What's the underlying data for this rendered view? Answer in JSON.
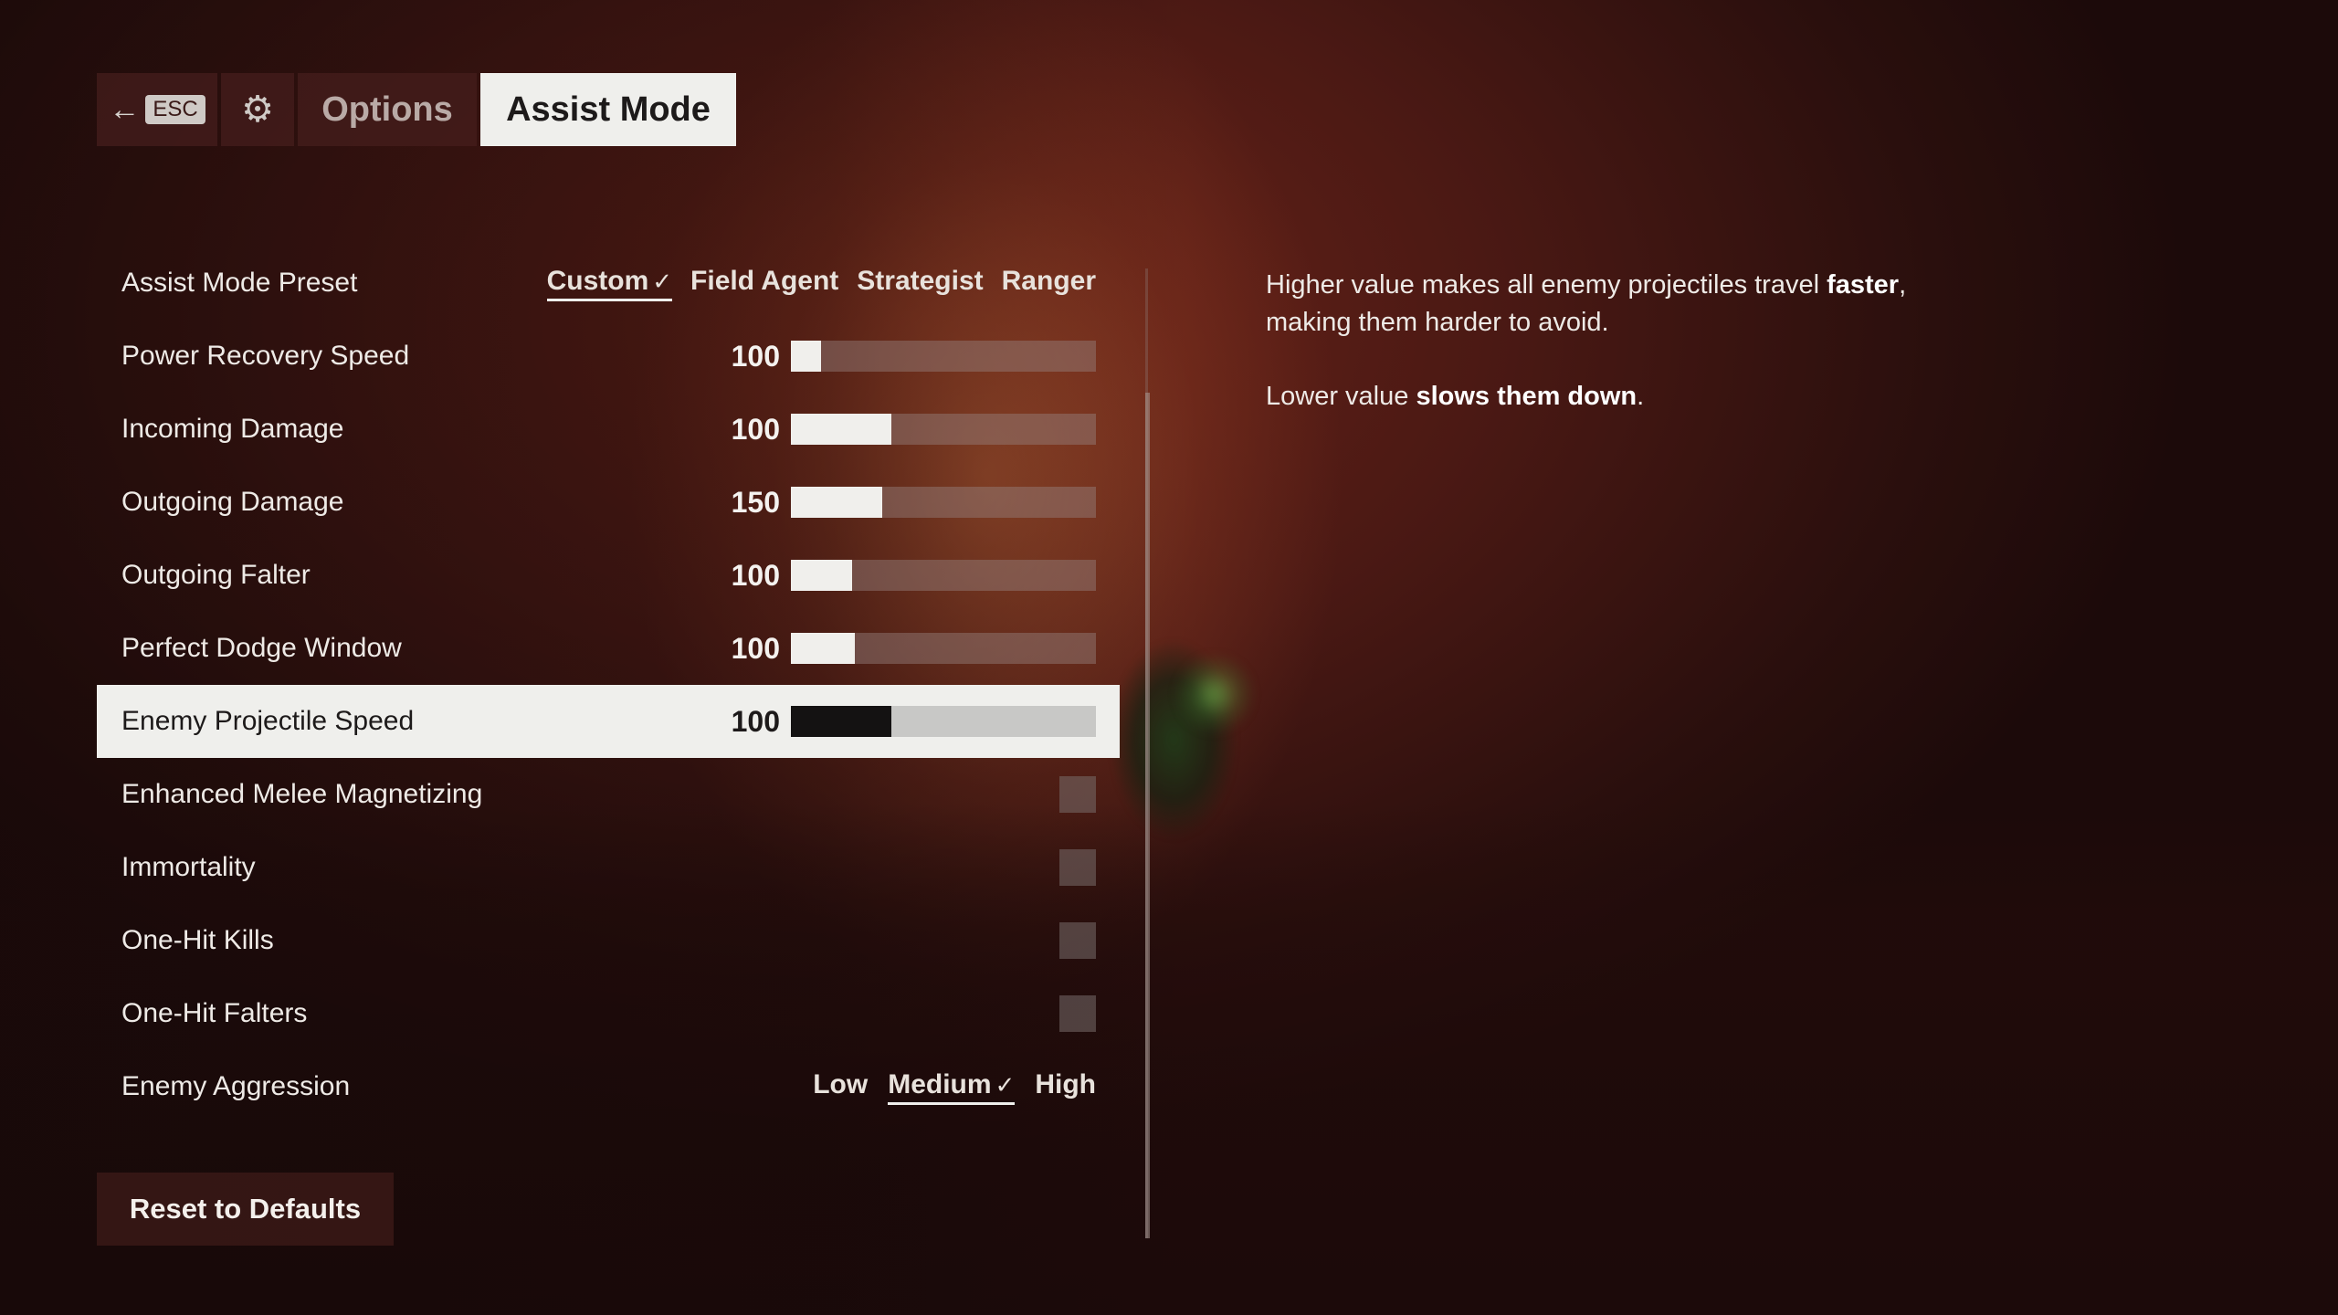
{
  "topbar": {
    "esc_label": "ESC",
    "options_tab": "Options",
    "assist_tab": "Assist Mode"
  },
  "preset": {
    "label": "Assist Mode Preset",
    "options": [
      "Custom",
      "Field Agent",
      "Strategist",
      "Ranger"
    ],
    "selected": "Custom"
  },
  "sliders": [
    {
      "label": "Power Recovery Speed",
      "value": "100",
      "fill_fraction": 0.1
    },
    {
      "label": "Incoming Damage",
      "value": "100",
      "fill_fraction": 0.33
    },
    {
      "label": "Outgoing Damage",
      "value": "150",
      "fill_fraction": 0.3
    },
    {
      "label": "Outgoing Falter",
      "value": "100",
      "fill_fraction": 0.2
    },
    {
      "label": "Perfect Dodge Window",
      "value": "100",
      "fill_fraction": 0.21
    },
    {
      "label": "Enemy Projectile Speed",
      "value": "100",
      "fill_fraction": 0.33,
      "selected": true
    }
  ],
  "toggles": [
    {
      "label": "Enhanced Melee Magnetizing",
      "checked": false
    },
    {
      "label": "Immortality",
      "checked": false
    },
    {
      "label": "One-Hit Kills",
      "checked": false
    },
    {
      "label": "One-Hit Falters",
      "checked": false
    }
  ],
  "aggression": {
    "label": "Enemy Aggression",
    "options": [
      "Low",
      "Medium",
      "High"
    ],
    "selected": "Medium"
  },
  "reset_label": "Reset to Defaults",
  "description": {
    "p1_pre": "Higher value makes all enemy projectiles travel ",
    "p1_bold": "faster",
    "p1_post": ",",
    "p1_line2": "making them harder to avoid.",
    "p2_pre": "Lower value ",
    "p2_bold": "slows them down",
    "p2_post": "."
  },
  "colors": {
    "accent_light": "#efefec",
    "background_red": "#4b1914",
    "selected_fill": "#141212"
  }
}
